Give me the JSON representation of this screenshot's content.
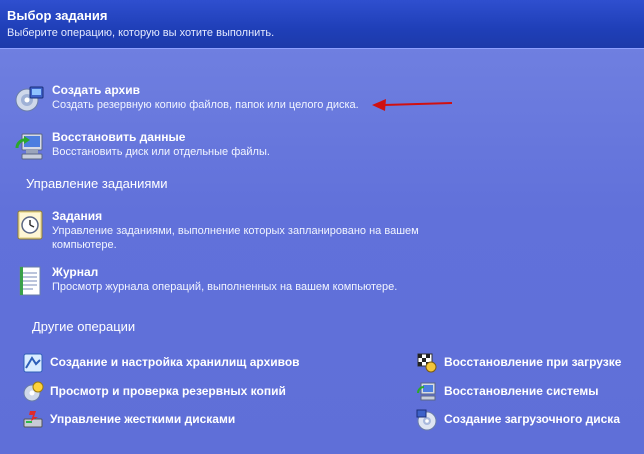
{
  "header": {
    "title": "Выбор задания",
    "subtitle": "Выберите операцию, которую вы хотите выполнить."
  },
  "tasks": [
    {
      "label": "Создать архив",
      "desc": "Создать резервную копию файлов, папок или целого диска.",
      "icon": "backup-disc-icon"
    },
    {
      "label": "Восстановить данные",
      "desc": "Восстановить диск или отдельные файлы.",
      "icon": "restore-computer-icon"
    }
  ],
  "management": {
    "title": "Управление заданиями",
    "items": [
      {
        "label": "Задания",
        "desc": "Управление заданиями, выполнение которых запланировано на вашем компьютере.",
        "icon": "clock-tasks-icon"
      },
      {
        "label": "Журнал",
        "desc": "Просмотр журнала операций, выполненных на вашем компьютере.",
        "icon": "log-document-icon"
      }
    ]
  },
  "other": {
    "title": "Другие операции",
    "left": [
      {
        "label": "Создание и настройка хранилищ архивов",
        "icon": "archive-storage-icon"
      },
      {
        "label": "Просмотр и проверка резервных копий",
        "icon": "verify-backup-icon"
      },
      {
        "label": "Управление жесткими дисками",
        "icon": "disk-management-icon"
      }
    ],
    "right": [
      {
        "label": "Восстановление при загрузке",
        "icon": "startup-recovery-icon"
      },
      {
        "label": "Восстановление системы",
        "icon": "system-restore-icon"
      },
      {
        "label": "Создание загрузочного диска",
        "icon": "bootable-disc-icon"
      }
    ]
  },
  "annotation": {
    "arrow_color": "#d01010",
    "icon": "red-arrow-icon"
  }
}
